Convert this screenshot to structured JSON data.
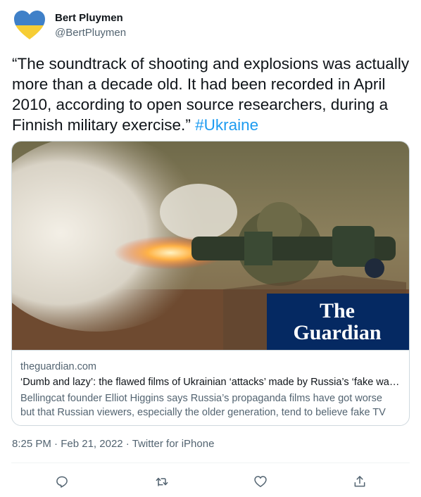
{
  "author": {
    "name": "Bert Pluymen",
    "handle": "@BertPluymen",
    "avatar_icon": "ukraine-heart-icon",
    "avatar_colors": {
      "top": "#3f80c8",
      "bottom": "#f6cd35"
    }
  },
  "tweet": {
    "text": "“The soundtrack of shooting and explosions was actually more than a decade old. It had been recorded in April 2010, according to open source researchers, during a Finnish military exercise.”",
    "hashtag": "#Ukraine"
  },
  "card": {
    "image_logo_line1": "The",
    "image_logo_line2": "Guardian",
    "domain": "theguardian.com",
    "title": "‘Dumb and lazy’: the flawed films of Ukrainian ‘attacks’ made by Russia’s ‘fake war’ campaign",
    "description_line1": "Bellingcat founder Elliot Higgins says Russia’s propaganda films have got worse",
    "description_line2": "but that Russian viewers, especially the older generation, tend to believe fake TV"
  },
  "meta": {
    "time": "8:25 PM",
    "separator": "·",
    "date": "Feb 21, 2022",
    "source": "Twitter for iPhone"
  },
  "actions": [
    {
      "icon": "reply-icon"
    },
    {
      "icon": "retweet-icon"
    },
    {
      "icon": "like-icon"
    },
    {
      "icon": "share-icon"
    }
  ],
  "colors": {
    "link": "#1d9bf0",
    "secondary_text": "#536471",
    "guardian_blue": "#052962"
  }
}
